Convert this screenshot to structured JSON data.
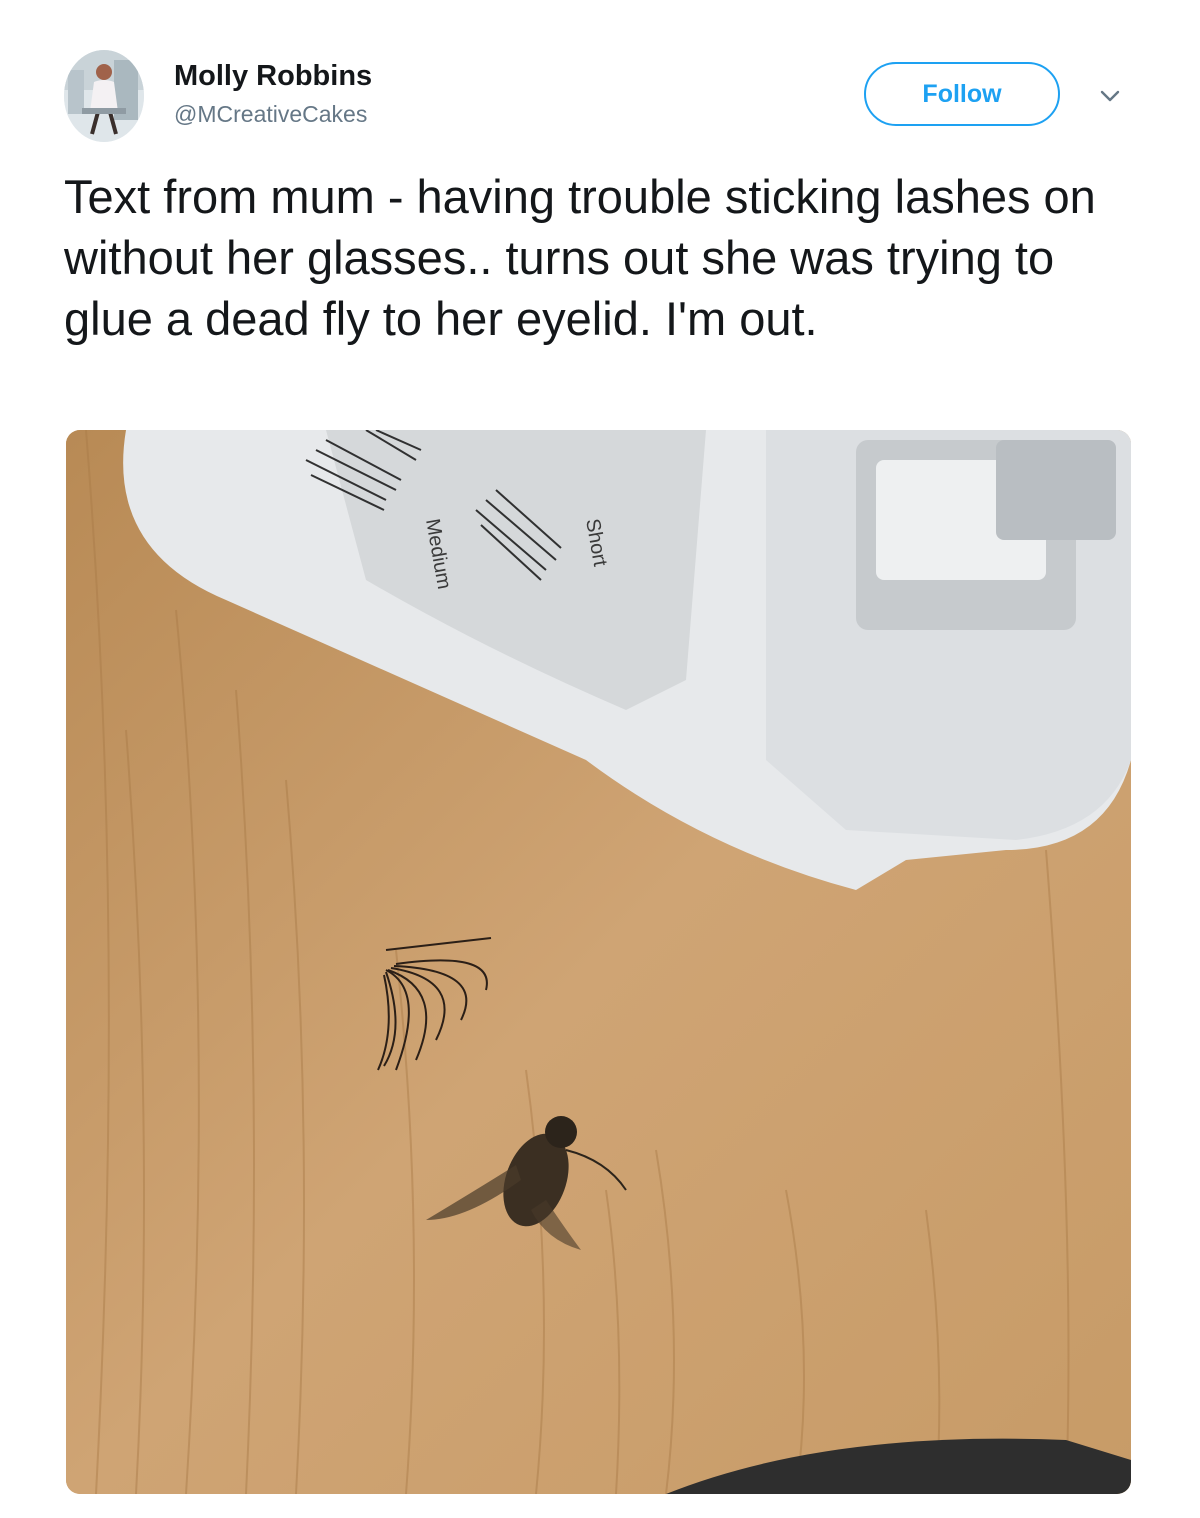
{
  "user": {
    "display_name": "Molly Robbins",
    "screen_name": "@MCreativeCakes"
  },
  "actions": {
    "follow_label": "Follow",
    "more_icon": "chevron-down-icon"
  },
  "tweet": {
    "text": "Text from mum - having trouble sticking lashes on without her glasses.. turns out she was trying to glue a dead fly to her eyelid. I'm out."
  },
  "photo": {
    "tray_label_medium": "Medium",
    "tray_label_short": "Short"
  },
  "colors": {
    "accent": "#1da1f2",
    "text_primary": "#14171a",
    "text_secondary": "#657786"
  }
}
